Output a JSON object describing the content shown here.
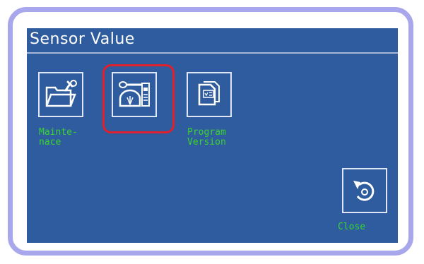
{
  "screen": {
    "title": "Sensor Value"
  },
  "icons": {
    "maintenance": {
      "label_line1": "Mainte-",
      "label_line2": "nace",
      "icon": "folder-wrench-icon"
    },
    "sensor_value": {
      "icon": "meter-sensor-icon",
      "selected": true
    },
    "program_version": {
      "label_line1": "Program",
      "label_line2": "Version",
      "icon": "document-version-icon"
    },
    "close": {
      "label": "Close",
      "icon": "return-arrow-icon"
    }
  },
  "colors": {
    "screen_background": "#2f5c9e",
    "label_text": "#39d52c",
    "selection_highlight": "#e0202a",
    "bezel": "#a9a7ec"
  }
}
